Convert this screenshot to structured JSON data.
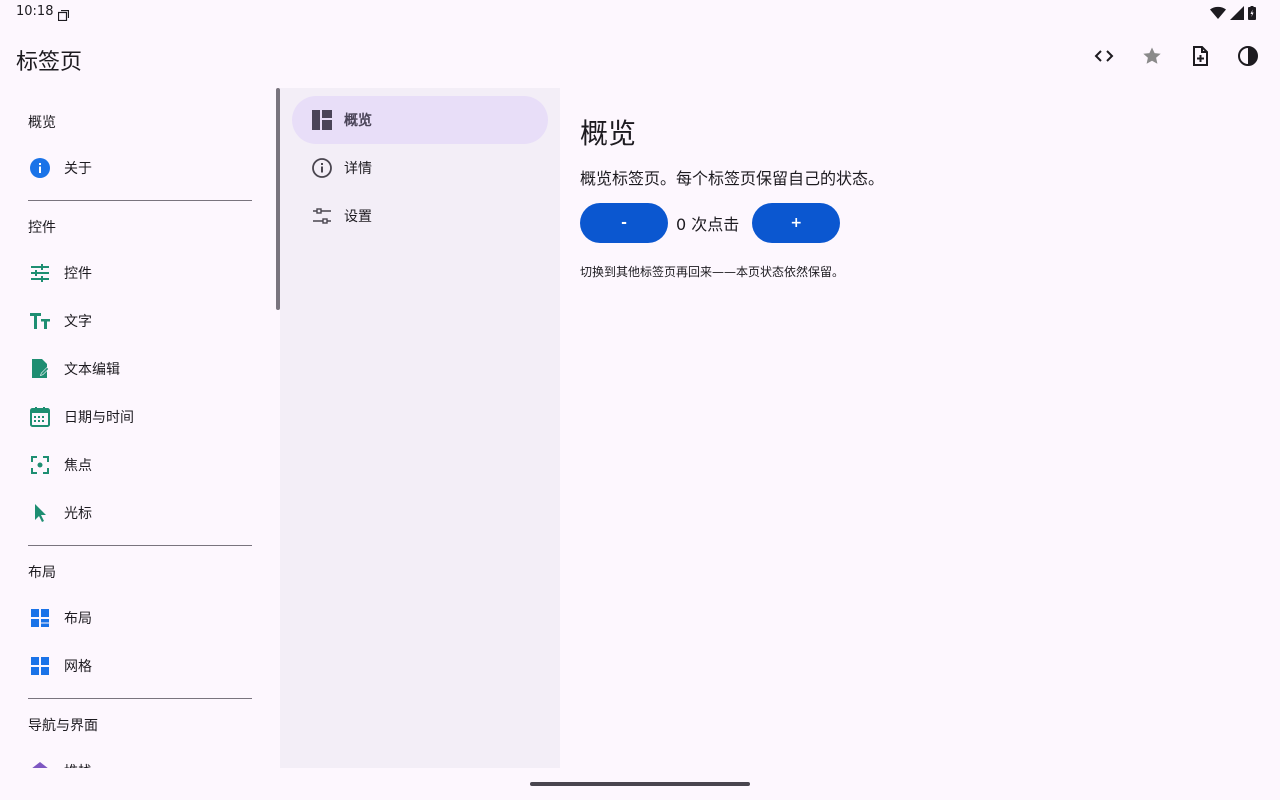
{
  "status": {
    "time": "10:18",
    "icons": [
      "notification-icon",
      "wifi-icon",
      "signal-icon",
      "battery-icon"
    ]
  },
  "appbar": {
    "title": "标签页",
    "actions": [
      "code-icon",
      "star-icon",
      "note-add-icon",
      "contrast-icon"
    ]
  },
  "leftnav": {
    "sections": [
      {
        "title": "概览",
        "items": [
          {
            "label": "关于",
            "icon": "info-icon"
          }
        ]
      },
      {
        "title": "控件",
        "items": [
          {
            "label": "控件",
            "icon": "tune-icon"
          },
          {
            "label": "文字",
            "icon": "text-fields-icon"
          },
          {
            "label": "文本编辑",
            "icon": "edit-note-icon"
          },
          {
            "label": "日期与时间",
            "icon": "calendar-icon"
          },
          {
            "label": "焦点",
            "icon": "focus-icon"
          },
          {
            "label": "光标",
            "icon": "cursor-icon"
          }
        ]
      },
      {
        "title": "布局",
        "items": [
          {
            "label": "布局",
            "icon": "dashboard-icon"
          },
          {
            "label": "网格",
            "icon": "grid-icon"
          }
        ]
      },
      {
        "title": "导航与界面",
        "items": [
          {
            "label": "堆栈",
            "icon": "layers-icon"
          }
        ]
      }
    ]
  },
  "tabs": [
    {
      "label": "概览",
      "icon": "dashboard-icon",
      "active": true
    },
    {
      "label": "详情",
      "icon": "info-outline-icon",
      "active": false
    },
    {
      "label": "设置",
      "icon": "tune-icon",
      "active": false
    }
  ],
  "content": {
    "title": "概览",
    "description": "概览标签页。每个标签页保留自己的状态。",
    "decrement_label": "-",
    "increment_label": "+",
    "count": "0",
    "count_suffix": "次点击",
    "hint": "切换到其他标签页再回来——本页状态依然保留。"
  },
  "colors": {
    "accent": "#0b57d0",
    "nav_icon_green": "#1e8e72",
    "nav_icon_blue": "#1a73e8",
    "active_tab": "#e8def8",
    "rail_bg": "#f3eef7"
  }
}
